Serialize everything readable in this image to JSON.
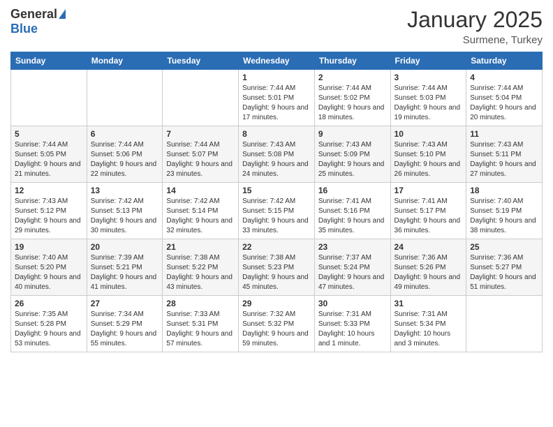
{
  "header": {
    "logo_general": "General",
    "logo_blue": "Blue",
    "month": "January 2025",
    "location": "Surmene, Turkey"
  },
  "weekdays": [
    "Sunday",
    "Monday",
    "Tuesday",
    "Wednesday",
    "Thursday",
    "Friday",
    "Saturday"
  ],
  "weeks": [
    [
      {
        "day": "",
        "sunrise": "",
        "sunset": "",
        "daylight": ""
      },
      {
        "day": "",
        "sunrise": "",
        "sunset": "",
        "daylight": ""
      },
      {
        "day": "",
        "sunrise": "",
        "sunset": "",
        "daylight": ""
      },
      {
        "day": "1",
        "sunrise": "Sunrise: 7:44 AM",
        "sunset": "Sunset: 5:01 PM",
        "daylight": "Daylight: 9 hours and 17 minutes."
      },
      {
        "day": "2",
        "sunrise": "Sunrise: 7:44 AM",
        "sunset": "Sunset: 5:02 PM",
        "daylight": "Daylight: 9 hours and 18 minutes."
      },
      {
        "day": "3",
        "sunrise": "Sunrise: 7:44 AM",
        "sunset": "Sunset: 5:03 PM",
        "daylight": "Daylight: 9 hours and 19 minutes."
      },
      {
        "day": "4",
        "sunrise": "Sunrise: 7:44 AM",
        "sunset": "Sunset: 5:04 PM",
        "daylight": "Daylight: 9 hours and 20 minutes."
      }
    ],
    [
      {
        "day": "5",
        "sunrise": "Sunrise: 7:44 AM",
        "sunset": "Sunset: 5:05 PM",
        "daylight": "Daylight: 9 hours and 21 minutes."
      },
      {
        "day": "6",
        "sunrise": "Sunrise: 7:44 AM",
        "sunset": "Sunset: 5:06 PM",
        "daylight": "Daylight: 9 hours and 22 minutes."
      },
      {
        "day": "7",
        "sunrise": "Sunrise: 7:44 AM",
        "sunset": "Sunset: 5:07 PM",
        "daylight": "Daylight: 9 hours and 23 minutes."
      },
      {
        "day": "8",
        "sunrise": "Sunrise: 7:43 AM",
        "sunset": "Sunset: 5:08 PM",
        "daylight": "Daylight: 9 hours and 24 minutes."
      },
      {
        "day": "9",
        "sunrise": "Sunrise: 7:43 AM",
        "sunset": "Sunset: 5:09 PM",
        "daylight": "Daylight: 9 hours and 25 minutes."
      },
      {
        "day": "10",
        "sunrise": "Sunrise: 7:43 AM",
        "sunset": "Sunset: 5:10 PM",
        "daylight": "Daylight: 9 hours and 26 minutes."
      },
      {
        "day": "11",
        "sunrise": "Sunrise: 7:43 AM",
        "sunset": "Sunset: 5:11 PM",
        "daylight": "Daylight: 9 hours and 27 minutes."
      }
    ],
    [
      {
        "day": "12",
        "sunrise": "Sunrise: 7:43 AM",
        "sunset": "Sunset: 5:12 PM",
        "daylight": "Daylight: 9 hours and 29 minutes."
      },
      {
        "day": "13",
        "sunrise": "Sunrise: 7:42 AM",
        "sunset": "Sunset: 5:13 PM",
        "daylight": "Daylight: 9 hours and 30 minutes."
      },
      {
        "day": "14",
        "sunrise": "Sunrise: 7:42 AM",
        "sunset": "Sunset: 5:14 PM",
        "daylight": "Daylight: 9 hours and 32 minutes."
      },
      {
        "day": "15",
        "sunrise": "Sunrise: 7:42 AM",
        "sunset": "Sunset: 5:15 PM",
        "daylight": "Daylight: 9 hours and 33 minutes."
      },
      {
        "day": "16",
        "sunrise": "Sunrise: 7:41 AM",
        "sunset": "Sunset: 5:16 PM",
        "daylight": "Daylight: 9 hours and 35 minutes."
      },
      {
        "day": "17",
        "sunrise": "Sunrise: 7:41 AM",
        "sunset": "Sunset: 5:17 PM",
        "daylight": "Daylight: 9 hours and 36 minutes."
      },
      {
        "day": "18",
        "sunrise": "Sunrise: 7:40 AM",
        "sunset": "Sunset: 5:19 PM",
        "daylight": "Daylight: 9 hours and 38 minutes."
      }
    ],
    [
      {
        "day": "19",
        "sunrise": "Sunrise: 7:40 AM",
        "sunset": "Sunset: 5:20 PM",
        "daylight": "Daylight: 9 hours and 40 minutes."
      },
      {
        "day": "20",
        "sunrise": "Sunrise: 7:39 AM",
        "sunset": "Sunset: 5:21 PM",
        "daylight": "Daylight: 9 hours and 41 minutes."
      },
      {
        "day": "21",
        "sunrise": "Sunrise: 7:38 AM",
        "sunset": "Sunset: 5:22 PM",
        "daylight": "Daylight: 9 hours and 43 minutes."
      },
      {
        "day": "22",
        "sunrise": "Sunrise: 7:38 AM",
        "sunset": "Sunset: 5:23 PM",
        "daylight": "Daylight: 9 hours and 45 minutes."
      },
      {
        "day": "23",
        "sunrise": "Sunrise: 7:37 AM",
        "sunset": "Sunset: 5:24 PM",
        "daylight": "Daylight: 9 hours and 47 minutes."
      },
      {
        "day": "24",
        "sunrise": "Sunrise: 7:36 AM",
        "sunset": "Sunset: 5:26 PM",
        "daylight": "Daylight: 9 hours and 49 minutes."
      },
      {
        "day": "25",
        "sunrise": "Sunrise: 7:36 AM",
        "sunset": "Sunset: 5:27 PM",
        "daylight": "Daylight: 9 hours and 51 minutes."
      }
    ],
    [
      {
        "day": "26",
        "sunrise": "Sunrise: 7:35 AM",
        "sunset": "Sunset: 5:28 PM",
        "daylight": "Daylight: 9 hours and 53 minutes."
      },
      {
        "day": "27",
        "sunrise": "Sunrise: 7:34 AM",
        "sunset": "Sunset: 5:29 PM",
        "daylight": "Daylight: 9 hours and 55 minutes."
      },
      {
        "day": "28",
        "sunrise": "Sunrise: 7:33 AM",
        "sunset": "Sunset: 5:31 PM",
        "daylight": "Daylight: 9 hours and 57 minutes."
      },
      {
        "day": "29",
        "sunrise": "Sunrise: 7:32 AM",
        "sunset": "Sunset: 5:32 PM",
        "daylight": "Daylight: 9 hours and 59 minutes."
      },
      {
        "day": "30",
        "sunrise": "Sunrise: 7:31 AM",
        "sunset": "Sunset: 5:33 PM",
        "daylight": "Daylight: 10 hours and 1 minute."
      },
      {
        "day": "31",
        "sunrise": "Sunrise: 7:31 AM",
        "sunset": "Sunset: 5:34 PM",
        "daylight": "Daylight: 10 hours and 3 minutes."
      },
      {
        "day": "",
        "sunrise": "",
        "sunset": "",
        "daylight": ""
      }
    ]
  ]
}
